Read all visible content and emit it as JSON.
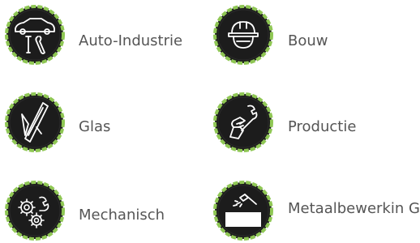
{
  "colors": {
    "ring": "#8fc754",
    "ring_dark": "#1c1c1c",
    "icon_bg": "#1c1c1c",
    "icon_fg": "#ffffff",
    "text": "#555555"
  },
  "categories": [
    {
      "label": "Auto-Industrie",
      "icon": "car-wrench-icon"
    },
    {
      "label": "Bouw",
      "icon": "hard-hat-icon"
    },
    {
      "label": "Glas",
      "icon": "window-glass-icon"
    },
    {
      "label": "Productie",
      "icon": "hand-wrench-icon"
    },
    {
      "label": "Mechanisch",
      "icon": "gears-icon"
    },
    {
      "label": "Metaalbewerkin G",
      "icon": "metal-cutting-icon"
    }
  ]
}
